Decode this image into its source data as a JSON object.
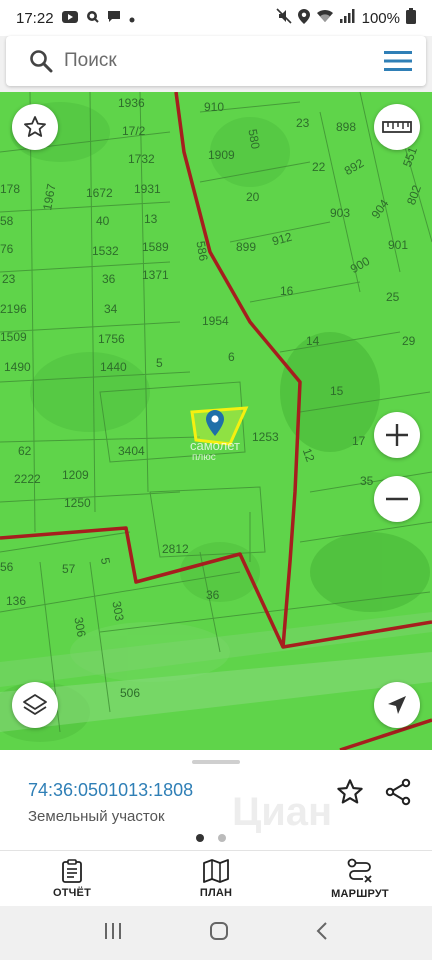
{
  "status_bar": {
    "time": "17:22",
    "battery": "100%"
  },
  "search": {
    "placeholder": "Поиск"
  },
  "map": {
    "parcels": [
      "1936",
      "910",
      "580",
      "17/2",
      "1909",
      "23",
      "898",
      "551",
      "1732",
      "22",
      "892",
      "1931",
      "1672",
      "20",
      "903",
      "904",
      "802",
      "1967",
      "40",
      "13",
      "912",
      "899",
      "901",
      "178",
      "1532",
      "1589",
      "586",
      "900",
      "58",
      "76",
      "36",
      "1371",
      "16",
      "25",
      "23",
      "1954",
      "2196",
      "34",
      "1509",
      "1756",
      "14",
      "29",
      "6",
      "1490",
      "1440",
      "5",
      "15",
      "1253",
      "62",
      "3404",
      "17",
      "12",
      "2222",
      "1209",
      "35",
      "1250",
      "2812",
      "56",
      "57",
      "36",
      "136",
      "5",
      "303",
      "306",
      "506"
    ],
    "watermark_line1": "самолет",
    "watermark_line2": "плюс"
  },
  "info_card": {
    "cadastral_number": "74:36:0501013:1808",
    "object_type": "Земельный участок",
    "watermark": "Циан"
  },
  "bottom_nav": {
    "report_label": "ОТЧЁТ",
    "plan_label": "ПЛАН",
    "route_label": "МАРШРУТ"
  },
  "colors": {
    "map_green": "#5fd44a",
    "parcel_line": "#3f8f34",
    "border_red": "#a61e1e",
    "selected_parcel": "#f5f010",
    "link_blue": "#2f7fb6"
  }
}
